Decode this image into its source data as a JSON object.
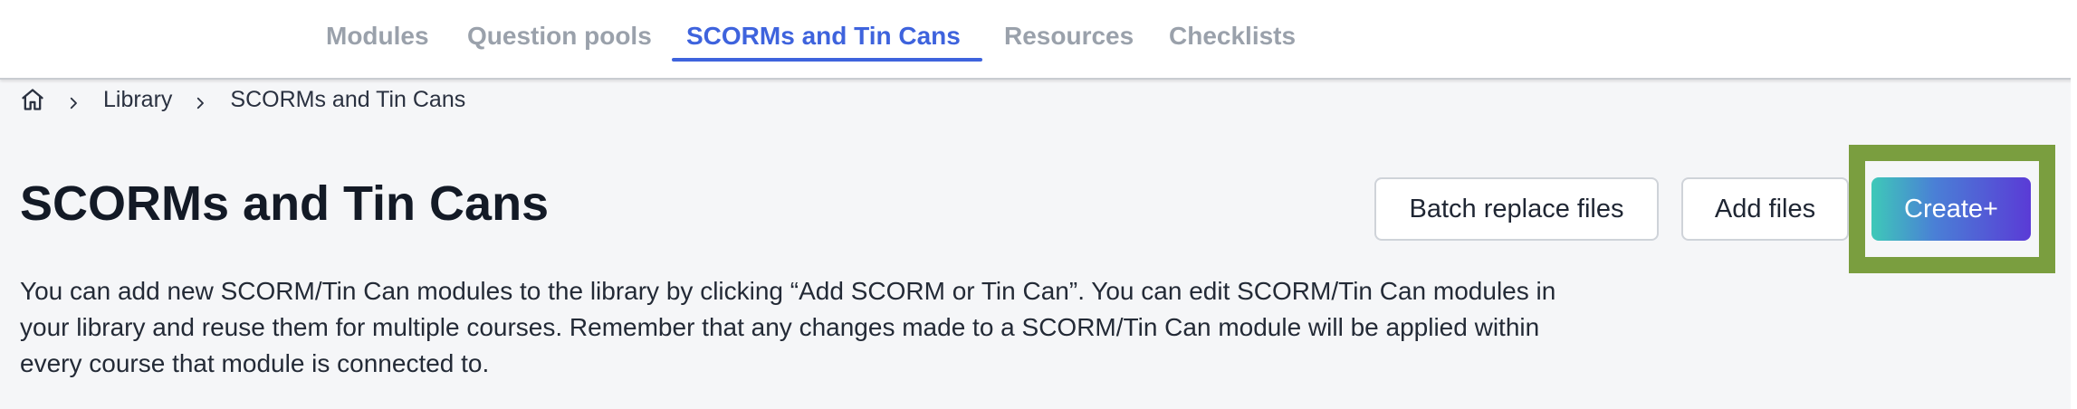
{
  "tabs": [
    {
      "label": "Modules",
      "active": false
    },
    {
      "label": "Question pools",
      "active": false
    },
    {
      "label": "SCORMs and Tin Cans",
      "active": true
    },
    {
      "label": "Resources",
      "active": false
    },
    {
      "label": "Checklists",
      "active": false
    }
  ],
  "breadcrumb": {
    "home_icon": "home-icon",
    "separator_icon": "chevron-right-icon",
    "items": [
      "Library",
      "SCORMs and Tin Cans"
    ]
  },
  "header": {
    "title": "SCORMs and Tin Cans"
  },
  "actions": {
    "batch_replace_label": "Batch replace files",
    "add_files_label": "Add files",
    "create_label": "Create+"
  },
  "description": {
    "lines": [
      "You can add new SCORM/Tin Can modules to the library by clicking “Add SCORM or Tin Can”. You can edit SCORM/Tin Can modules in",
      "your library and reuse them for multiple courses. Remember that any changes made to a SCORM/Tin Can module will be applied within",
      "every course that module is connected to."
    ]
  },
  "colors": {
    "accent": "#3e63dd",
    "tab_inactive": "#9aa1ab",
    "highlight_box": "#7a9e3f",
    "create_gradient_start": "#3ec9b8",
    "create_gradient_end": "#5a3bd6",
    "page_background": "#f5f6f8"
  }
}
